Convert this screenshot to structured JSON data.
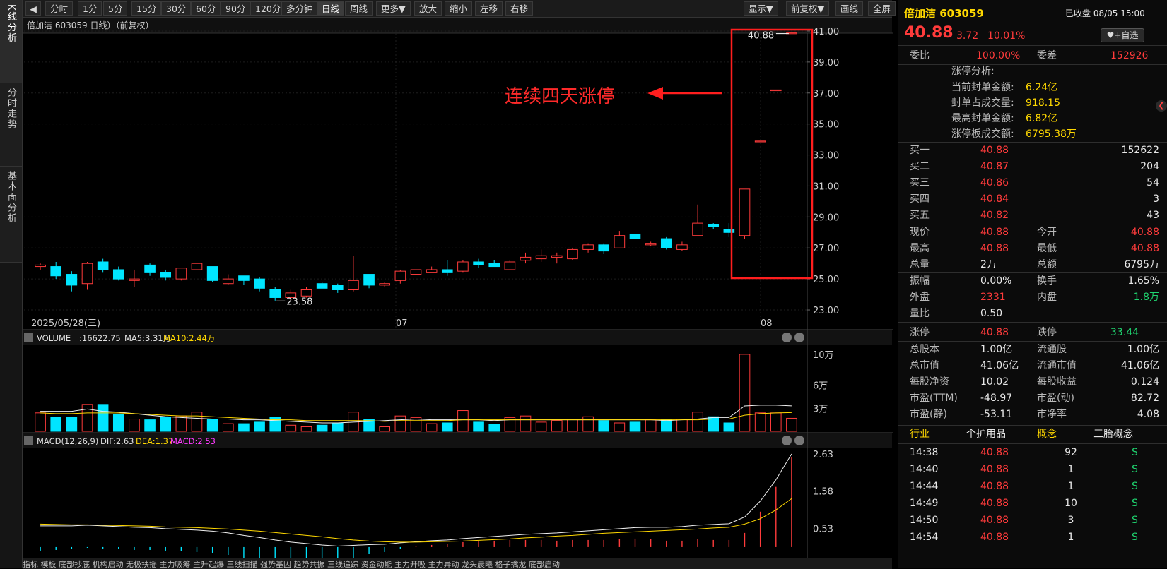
{
  "toolbar": {
    "nav_icon": "back-arrow-icon",
    "periods": [
      "分时",
      "1分",
      "5分",
      "15分",
      "30分",
      "60分",
      "90分",
      "120分",
      "多分钟",
      "日线",
      "周线",
      "更多▼"
    ],
    "active": "日线",
    "tools": [
      "放大",
      "缩小",
      "左移",
      "右移"
    ],
    "right_tools": [
      "显示▼",
      "前复权▼",
      "画线",
      "全屏"
    ]
  },
  "left_tabs": [
    "K线分析",
    "分时走势",
    "基本面分析"
  ],
  "chart": {
    "header": "倍加洁 603059 日线）（前复权）",
    "annotation": "连续四天涨停",
    "high_label": "40.88",
    "low_label": "23.58",
    "date_left": "2025/05/28(三)",
    "month_07": "07",
    "month_08": "08",
    "price_ticks": [
      "41.00",
      "39.00",
      "37.00",
      "35.00",
      "33.00",
      "31.00",
      "29.00",
      "27.00",
      "25.00",
      "23.00"
    ],
    "accent_rise": "#ff3b3b",
    "accent_fall": "#00e5ff"
  },
  "chart_data": {
    "type": "candlestick",
    "ylim": [
      22.5,
      41.5
    ],
    "candles": [
      [
        25.8,
        25.9,
        25.6,
        26.0
      ],
      [
        25.8,
        25.2,
        25.0,
        26.1
      ],
      [
        25.3,
        24.6,
        24.2,
        25.5
      ],
      [
        24.7,
        26.0,
        24.3,
        26.1
      ],
      [
        26.1,
        25.6,
        25.4,
        26.3
      ],
      [
        25.6,
        25.0,
        24.9,
        25.8
      ],
      [
        24.9,
        25.0,
        24.5,
        25.6
      ],
      [
        25.9,
        25.4,
        25.2,
        26.0
      ],
      [
        25.4,
        25.1,
        24.9,
        25.6
      ],
      [
        25.0,
        25.7,
        24.9,
        25.7
      ],
      [
        25.6,
        26.0,
        25.5,
        26.3
      ],
      [
        25.8,
        24.9,
        24.8,
        25.8
      ],
      [
        24.7,
        25.0,
        24.6,
        25.3
      ],
      [
        25.2,
        24.9,
        24.6,
        25.2
      ],
      [
        25.0,
        24.4,
        24.2,
        25.1
      ],
      [
        24.3,
        23.8,
        23.6,
        24.5
      ],
      [
        23.8,
        24.1,
        23.6,
        24.3
      ],
      [
        23.9,
        24.3,
        23.8,
        24.5
      ],
      [
        24.7,
        24.4,
        24.4,
        24.8
      ],
      [
        24.6,
        24.3,
        24.1,
        24.7
      ],
      [
        24.3,
        24.9,
        24.2,
        26.5
      ],
      [
        25.3,
        24.6,
        24.4,
        25.3
      ],
      [
        24.6,
        24.7,
        24.5,
        24.8
      ],
      [
        24.9,
        25.5,
        24.7,
        25.6
      ],
      [
        25.3,
        25.6,
        25.2,
        25.8
      ],
      [
        25.4,
        25.6,
        25.4,
        25.8
      ],
      [
        25.6,
        25.4,
        25.2,
        26.2
      ],
      [
        25.5,
        26.1,
        25.4,
        26.2
      ],
      [
        26.1,
        25.9,
        25.7,
        26.3
      ],
      [
        26.0,
        25.8,
        25.8,
        26.2
      ],
      [
        25.6,
        26.1,
        25.6,
        26.2
      ],
      [
        26.2,
        26.4,
        26.0,
        26.7
      ],
      [
        26.3,
        26.5,
        26.1,
        26.9
      ],
      [
        26.4,
        26.5,
        26.0,
        26.7
      ],
      [
        26.3,
        26.9,
        26.2,
        27.0
      ],
      [
        26.9,
        27.2,
        26.7,
        27.3
      ],
      [
        27.2,
        26.8,
        26.6,
        27.3
      ],
      [
        27.0,
        27.8,
        27.0,
        28.1
      ],
      [
        27.9,
        27.6,
        27.5,
        28.2
      ],
      [
        27.2,
        27.3,
        27.1,
        27.4
      ],
      [
        27.6,
        27.0,
        26.9,
        27.7
      ],
      [
        26.9,
        27.2,
        26.8,
        27.4
      ],
      [
        27.8,
        28.6,
        27.8,
        29.8
      ],
      [
        28.5,
        28.4,
        28.2,
        28.6
      ],
      [
        28.2,
        28.0,
        27.7,
        28.6
      ],
      [
        27.8,
        30.8,
        27.6,
        30.8
      ],
      [
        33.9,
        33.9,
        33.9,
        33.9
      ],
      [
        37.2,
        37.2,
        37.2,
        37.2
      ],
      [
        40.88,
        40.88,
        40.88,
        40.88
      ]
    ],
    "volume": {
      "label": "VOLUME",
      "value": ":16622.75",
      "ma5": "MA5:3.31万",
      "ma10": "MA10:2.44万",
      "ticks": [
        "10万",
        "6万",
        "3万"
      ],
      "ylim": [
        0,
        11
      ],
      "bars": [
        2.4,
        1.8,
        1.8,
        3.5,
        3.5,
        2.2,
        1.6,
        1.5,
        1.8,
        2.0,
        2.5,
        1.6,
        1.0,
        1.0,
        1.2,
        1.8,
        0.8,
        0.6,
        0.8,
        1.1,
        2.5,
        1.6,
        0.6,
        2.0,
        1.8,
        1.0,
        1.1,
        2.7,
        1.2,
        0.9,
        1.8,
        2.0,
        1.2,
        1.4,
        1.6,
        1.9,
        1.4,
        1.1,
        1.2,
        1.5,
        1.5,
        1.6,
        2.5,
        1.9,
        1.1,
        10.0,
        2.4,
        2.4,
        1.7
      ],
      "ma5_line": [
        2.6,
        2.6,
        2.6,
        2.9,
        2.6,
        2.5,
        2.3,
        2.1,
        1.9,
        1.8,
        1.7,
        1.6,
        1.6,
        1.5,
        1.5,
        1.4,
        1.3,
        1.2,
        1.1,
        1.1,
        1.2,
        1.3,
        1.4,
        1.5,
        1.6,
        1.5,
        1.5,
        1.5,
        1.5,
        1.4,
        1.5,
        1.5,
        1.5,
        1.5,
        1.5,
        1.5,
        1.5,
        1.5,
        1.5,
        1.5,
        1.4,
        1.5,
        1.6,
        1.8,
        1.8,
        3.3,
        3.4,
        3.4,
        3.31
      ],
      "ma10_line": [
        2.4,
        2.3,
        2.3,
        2.4,
        2.4,
        2.4,
        2.3,
        2.2,
        2.1,
        2.0,
        2.0,
        1.9,
        1.8,
        1.7,
        1.6,
        1.5,
        1.5,
        1.4,
        1.4,
        1.4,
        1.4,
        1.4,
        1.3,
        1.4,
        1.4,
        1.4,
        1.4,
        1.5,
        1.5,
        1.5,
        1.5,
        1.5,
        1.5,
        1.5,
        1.5,
        1.5,
        1.5,
        1.5,
        1.5,
        1.5,
        1.5,
        1.5,
        1.5,
        1.6,
        1.6,
        2.1,
        2.3,
        2.4,
        2.44
      ]
    },
    "macd": {
      "label": "MACD(12,26,9)",
      "dif": "DIF:2.63",
      "dea": "DEA:1.37",
      "macd": "MACD:2.53",
      "ticks": [
        "2.63",
        "1.58",
        "0.53"
      ],
      "ylim": [
        -0.3,
        2.75
      ],
      "dif_line": [
        0.6,
        0.6,
        0.6,
        0.62,
        0.6,
        0.58,
        0.56,
        0.55,
        0.52,
        0.5,
        0.48,
        0.45,
        0.4,
        0.33,
        0.27,
        0.2,
        0.14,
        0.1,
        0.06,
        0.03,
        0.05,
        0.07,
        0.08,
        0.12,
        0.15,
        0.18,
        0.2,
        0.24,
        0.27,
        0.3,
        0.33,
        0.36,
        0.38,
        0.4,
        0.43,
        0.46,
        0.49,
        0.52,
        0.55,
        0.56,
        0.56,
        0.58,
        0.62,
        0.64,
        0.66,
        0.85,
        1.3,
        1.9,
        2.63
      ],
      "dea_line": [
        0.65,
        0.64,
        0.63,
        0.63,
        0.62,
        0.61,
        0.6,
        0.59,
        0.57,
        0.56,
        0.55,
        0.53,
        0.51,
        0.48,
        0.45,
        0.41,
        0.37,
        0.33,
        0.29,
        0.24,
        0.2,
        0.17,
        0.15,
        0.14,
        0.14,
        0.15,
        0.16,
        0.17,
        0.19,
        0.21,
        0.23,
        0.26,
        0.28,
        0.31,
        0.33,
        0.36,
        0.39,
        0.41,
        0.43,
        0.45,
        0.47,
        0.49,
        0.51,
        0.54,
        0.56,
        0.65,
        0.8,
        1.05,
        1.37
      ],
      "hist": [
        -0.1,
        -0.08,
        -0.06,
        -0.02,
        -0.04,
        -0.06,
        -0.08,
        -0.08,
        -0.1,
        -0.12,
        -0.14,
        -0.16,
        -0.22,
        -0.3,
        -0.36,
        -0.42,
        -0.46,
        -0.46,
        -0.46,
        -0.42,
        -0.3,
        -0.2,
        -0.14,
        -0.04,
        0.02,
        0.06,
        0.08,
        0.14,
        0.16,
        0.18,
        0.2,
        0.2,
        0.2,
        0.18,
        0.2,
        0.2,
        0.2,
        0.22,
        0.24,
        0.22,
        0.18,
        0.18,
        0.22,
        0.2,
        0.2,
        0.4,
        1.0,
        1.7,
        2.53
      ]
    }
  },
  "right_panel": {
    "title": "倍加洁 603059",
    "status": "已收盘 08/05 15:00",
    "price": "40.88",
    "change": "3.72",
    "pct": "10.01%",
    "watch_button": "+自选",
    "weibi_label": "委比",
    "weibi": "100.00%",
    "weicha_label": "委差",
    "weicha": "152926",
    "limit_title": "涨停分析:",
    "limit_rows": [
      {
        "k": "当前封单金额:",
        "v": "6.24亿"
      },
      {
        "k": "封单占成交量:",
        "v": "918.15"
      },
      {
        "k": "最高封单金额:",
        "v": "6.82亿"
      },
      {
        "k": "涨停板成交额:",
        "v": "6795.38万"
      }
    ],
    "bids": [
      {
        "k": "买一",
        "p": "40.88",
        "v": "152622"
      },
      {
        "k": "买二",
        "p": "40.87",
        "v": "204"
      },
      {
        "k": "买三",
        "p": "40.86",
        "v": "54"
      },
      {
        "k": "买四",
        "p": "40.84",
        "v": "3"
      },
      {
        "k": "买五",
        "p": "40.82",
        "v": "43"
      }
    ],
    "quote": [
      {
        "k1": "现价",
        "v1": "40.88",
        "c1": "red",
        "k2": "今开",
        "v2": "40.88",
        "c2": "red"
      },
      {
        "k1": "最高",
        "v1": "40.88",
        "c1": "red",
        "k2": "最低",
        "v2": "40.88",
        "c2": "red"
      },
      {
        "k1": "总量",
        "v1": "2万",
        "c1": "wht",
        "k2": "总额",
        "v2": "6795万",
        "c2": "wht"
      }
    ],
    "stats": [
      {
        "k1": "振幅",
        "v1": "0.00%",
        "c1": "wht",
        "k2": "换手",
        "v2": "1.65%",
        "c2": "wht"
      },
      {
        "k1": "外盘",
        "v1": "2331",
        "c1": "red",
        "k2": "内盘",
        "v2": "1.8万",
        "c2": "grn"
      },
      {
        "k1": "量比",
        "v1": "0.50",
        "c1": "wht",
        "k2": "",
        "v2": "",
        "c2": "wht"
      }
    ],
    "limits": {
      "k1": "涨停",
      "v1": "40.88",
      "k2": "跌停",
      "v2": "33.44"
    },
    "fundamentals": [
      {
        "k1": "总股本",
        "v1": "1.00亿",
        "k2": "流通股",
        "v2": "1.00亿"
      },
      {
        "k1": "总市值",
        "v1": "41.06亿",
        "k2": "流通市值",
        "v2": "41.06亿"
      },
      {
        "k1": "每股净资",
        "v1": "10.02",
        "k2": "每股收益",
        "v2": "0.124"
      },
      {
        "k1": "市盈(TTM)",
        "v1": "-48.97",
        "k2": "市盈(动)",
        "v2": "82.72"
      },
      {
        "k1": "市盈(静)",
        "v1": "-53.11",
        "k2": "市净率",
        "v2": "4.08"
      }
    ],
    "industry_label": "行业",
    "industry": "个护用品",
    "concept_label": "概念",
    "concept": "三胎概念",
    "ticks": [
      {
        "t": "14:38",
        "p": "40.88",
        "v": "92",
        "s": "S"
      },
      {
        "t": "14:40",
        "p": "40.88",
        "v": "1",
        "s": "S"
      },
      {
        "t": "14:44",
        "p": "40.88",
        "v": "1",
        "s": "S"
      },
      {
        "t": "14:49",
        "p": "40.88",
        "v": "10",
        "s": "S"
      },
      {
        "t": "14:50",
        "p": "40.88",
        "v": "3",
        "s": "S"
      },
      {
        "t": "14:54",
        "p": "40.88",
        "v": "1",
        "s": "S"
      }
    ]
  },
  "bottom_bar": "指标  模板  底部抄底  机构启动  无极扶摇  主力吸筹  主升起爆  三线扫描  强势基因  趋势共振  三线追踪  资金动能  主力开吸  主力异动  龙头晨曦  格子擒龙  底部启动"
}
